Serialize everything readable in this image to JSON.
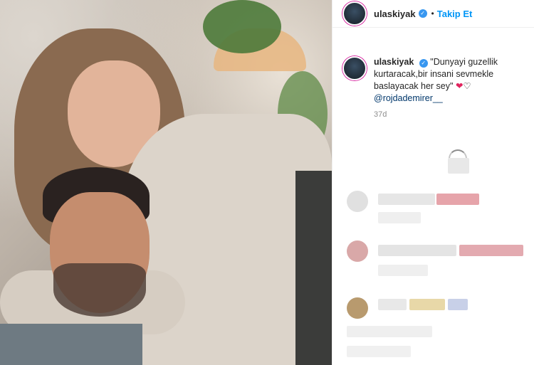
{
  "header": {
    "username": "ulaskiyak",
    "separator": "•",
    "follow_label": "Takip Et"
  },
  "caption": {
    "username": "ulaskiyak",
    "text": "\"Dunyayi guzellik kurtaracak,bir insani sevmekle baslayacak her sey\"",
    "heart_red": "❤",
    "heart_outline": "♡",
    "mention": "@rojdademirer__",
    "age": "37d"
  },
  "icons": {
    "verified": "verified-badge-icon",
    "loading": "loading-spinner-icon"
  },
  "colors": {
    "follow": "#0095f6",
    "verified": "#3897f0",
    "heart": "#e0245e"
  }
}
